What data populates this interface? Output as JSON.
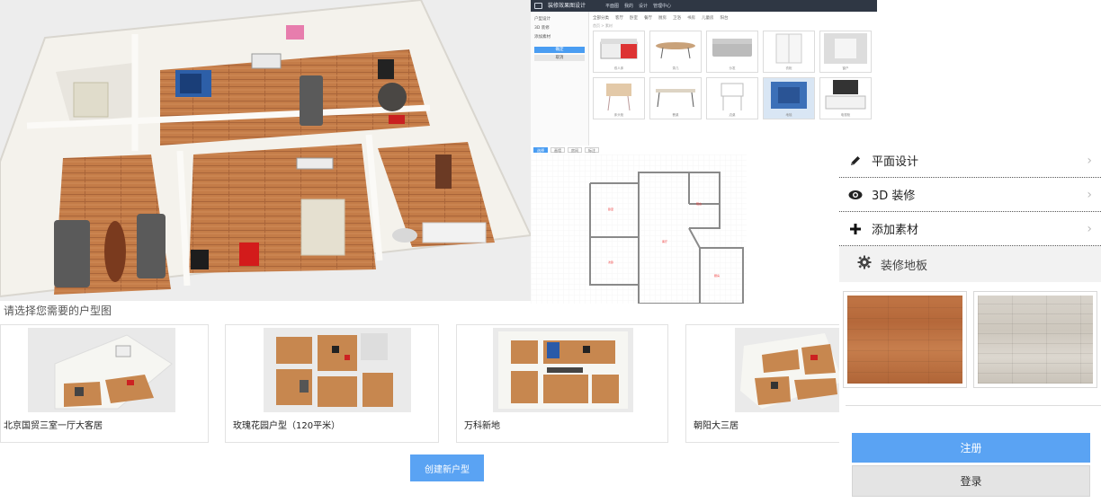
{
  "app_preview": {
    "title": "装修效果图设计",
    "top_nav": [
      "平面图",
      "我的",
      "设计",
      "管理中心"
    ],
    "sidebar": {
      "items": [
        "户型设计",
        "3D 装修",
        "添加素材"
      ],
      "primary_button": "确定",
      "secondary_button": "取消"
    },
    "tabs": [
      "全部分类",
      "客厅",
      "卧室",
      "餐厅",
      "厨房",
      "卫浴",
      "书房",
      "儿童房",
      "阳台"
    ],
    "breadcrumb": "首页 > 素材",
    "products": [
      {
        "name": "双人床",
        "kind": "bed"
      },
      {
        "name": "茶几",
        "kind": "table"
      },
      {
        "name": "沙发",
        "kind": "sofa"
      },
      {
        "name": "衣柜",
        "kind": "wardrobe"
      },
      {
        "name": "窗户",
        "kind": "window"
      },
      {
        "name": "床头柜",
        "kind": "nightstand"
      },
      {
        "name": "餐桌",
        "kind": "desk"
      },
      {
        "name": "边桌",
        "kind": "sidetable"
      },
      {
        "name": "地毯",
        "kind": "rug"
      },
      {
        "name": "电视柜",
        "kind": "tvstand"
      }
    ]
  },
  "plan_editor": {
    "toolbar": [
      "选择",
      "画墙",
      "房间",
      "标注"
    ],
    "rooms": [
      "卧室",
      "客厅",
      "阳台",
      "次卧",
      "厨房"
    ]
  },
  "menu": {
    "items": [
      {
        "label": "平面设计",
        "icon": "pencil-icon"
      },
      {
        "label": "3D 装修",
        "icon": "eye-icon"
      },
      {
        "label": "添加素材",
        "icon": "plus-icon"
      }
    ],
    "submenu": {
      "label": "装修地板",
      "icon": "gear-icon"
    },
    "textures": [
      {
        "name": "wood-floor",
        "color": "#b96d3e"
      },
      {
        "name": "gray-floor",
        "color": "#d3cdc4"
      }
    ]
  },
  "auth": {
    "register": "注册",
    "login": "登录"
  },
  "selection": {
    "title": "请选择您需要的户型图",
    "cards": [
      {
        "label": "北京国贸三室一厅大客居"
      },
      {
        "label": "玫瑰花园户型（120平米）"
      },
      {
        "label": "万科新地"
      },
      {
        "label": "朝阳大三居"
      }
    ],
    "create_button": "创建新户型"
  },
  "colors": {
    "accent": "#5aa3f3",
    "topbar": "#2f3744",
    "floor_wood": "#c07a48",
    "wall": "#f5f3ee"
  }
}
